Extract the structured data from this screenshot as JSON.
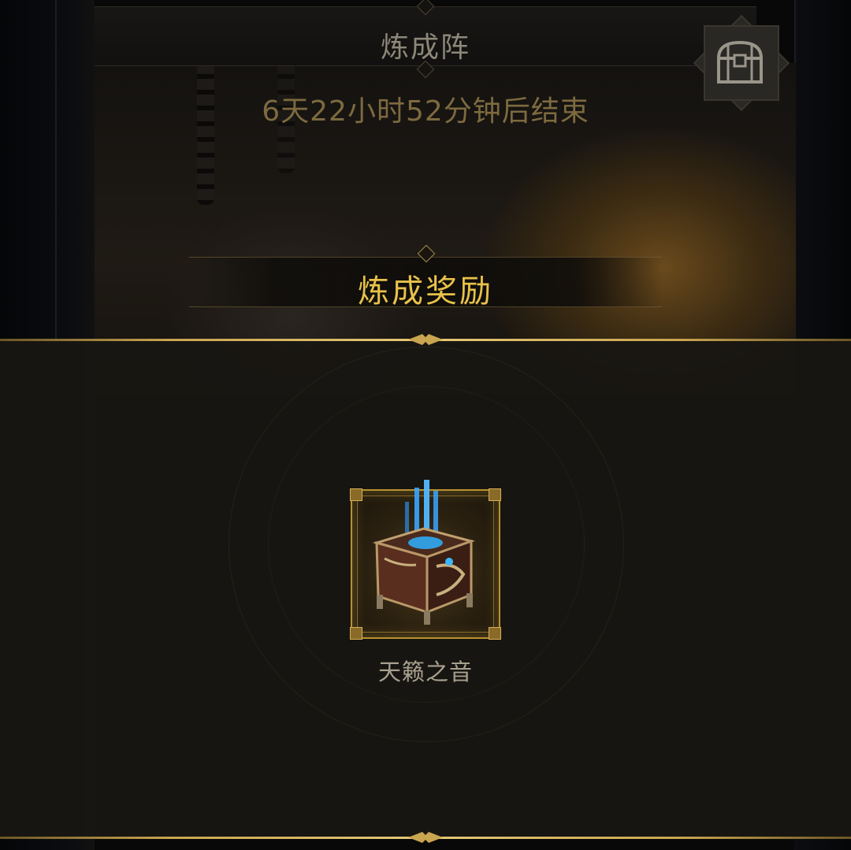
{
  "header": {
    "title": "炼成阵",
    "timer_text": "6天22小时52分钟后结束",
    "chest_icon": "treasure-chest-icon"
  },
  "rewards": {
    "section_title": "炼成奖励",
    "items": [
      {
        "name": "天籁之音",
        "icon": "glowing-chest-icon"
      }
    ]
  },
  "colors": {
    "gold": "#e8c24a",
    "timer": "#7d6a3f",
    "title": "#8c8778",
    "item_name": "#a8a08e",
    "panel": "#181612"
  }
}
